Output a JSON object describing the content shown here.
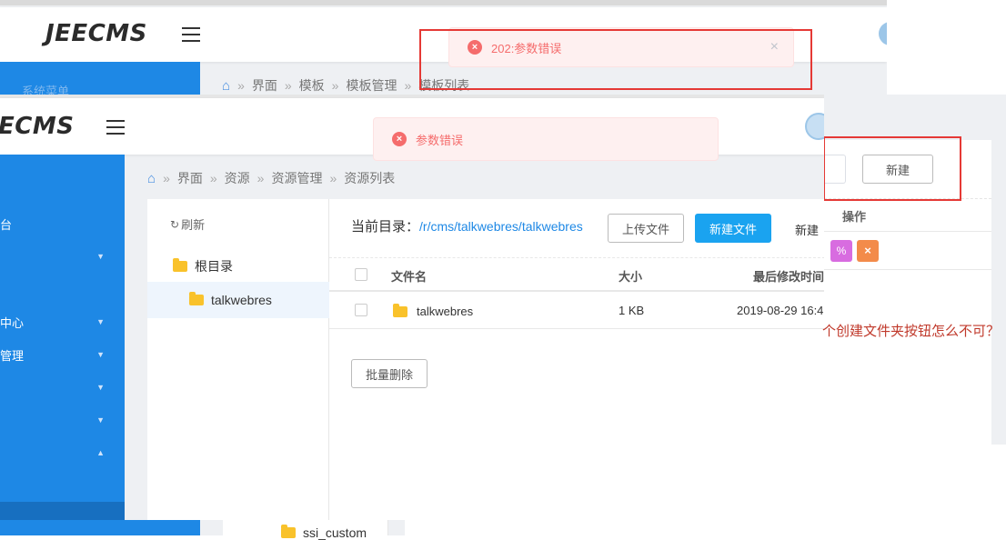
{
  "back": {
    "logo": "JEECMS",
    "sidebar_faded": "系统菜单",
    "breadcrumb": [
      "界面",
      "模板",
      "模板管理",
      "模板列表"
    ],
    "error_message": "202:参数错误",
    "new_button": "新建",
    "ops_header": "操作",
    "bottom_folder": "ssi_custom"
  },
  "front": {
    "logo": "ECMS",
    "error_message": "参数错误",
    "breadcrumb": [
      "界面",
      "资源",
      "资源管理",
      "资源列表"
    ],
    "sidebar_items": [
      {
        "label": "台",
        "caret": ""
      },
      {
        "label": "",
        "caret": "▼"
      },
      {
        "label": "",
        "caret": ""
      },
      {
        "label": "中心",
        "caret": "▼"
      },
      {
        "label": "管理",
        "caret": "▼"
      },
      {
        "label": "",
        "caret": "▼"
      },
      {
        "label": "",
        "caret": "▼"
      },
      {
        "label": "",
        "caret": "▲"
      },
      {
        "label": "",
        "caret": ""
      },
      {
        "label": "",
        "caret": ""
      }
    ],
    "tree": {
      "refresh": "刷新",
      "root": "根目录",
      "child": "talkwebres"
    },
    "current_dir_label": "当前目录：",
    "current_dir_path": "/r/cms/talkwebres/talkwebres",
    "upload_button": "上传文件",
    "new_file_button": "新建文件",
    "new_folder_button": "新建",
    "columns": [
      "文件名",
      "大小",
      "最后修改时间"
    ],
    "rows": [
      {
        "name": "talkwebres",
        "size": "1 KB",
        "modified": "2019-08-29 16:4"
      }
    ],
    "batch_delete": "批量删除"
  },
  "annotation": "个创建文件夹按钮怎么不可？",
  "colors": {
    "sidebar_blue": "#1e88e5",
    "highlight_red": "#e53935",
    "primary": "#1aa3f0"
  }
}
